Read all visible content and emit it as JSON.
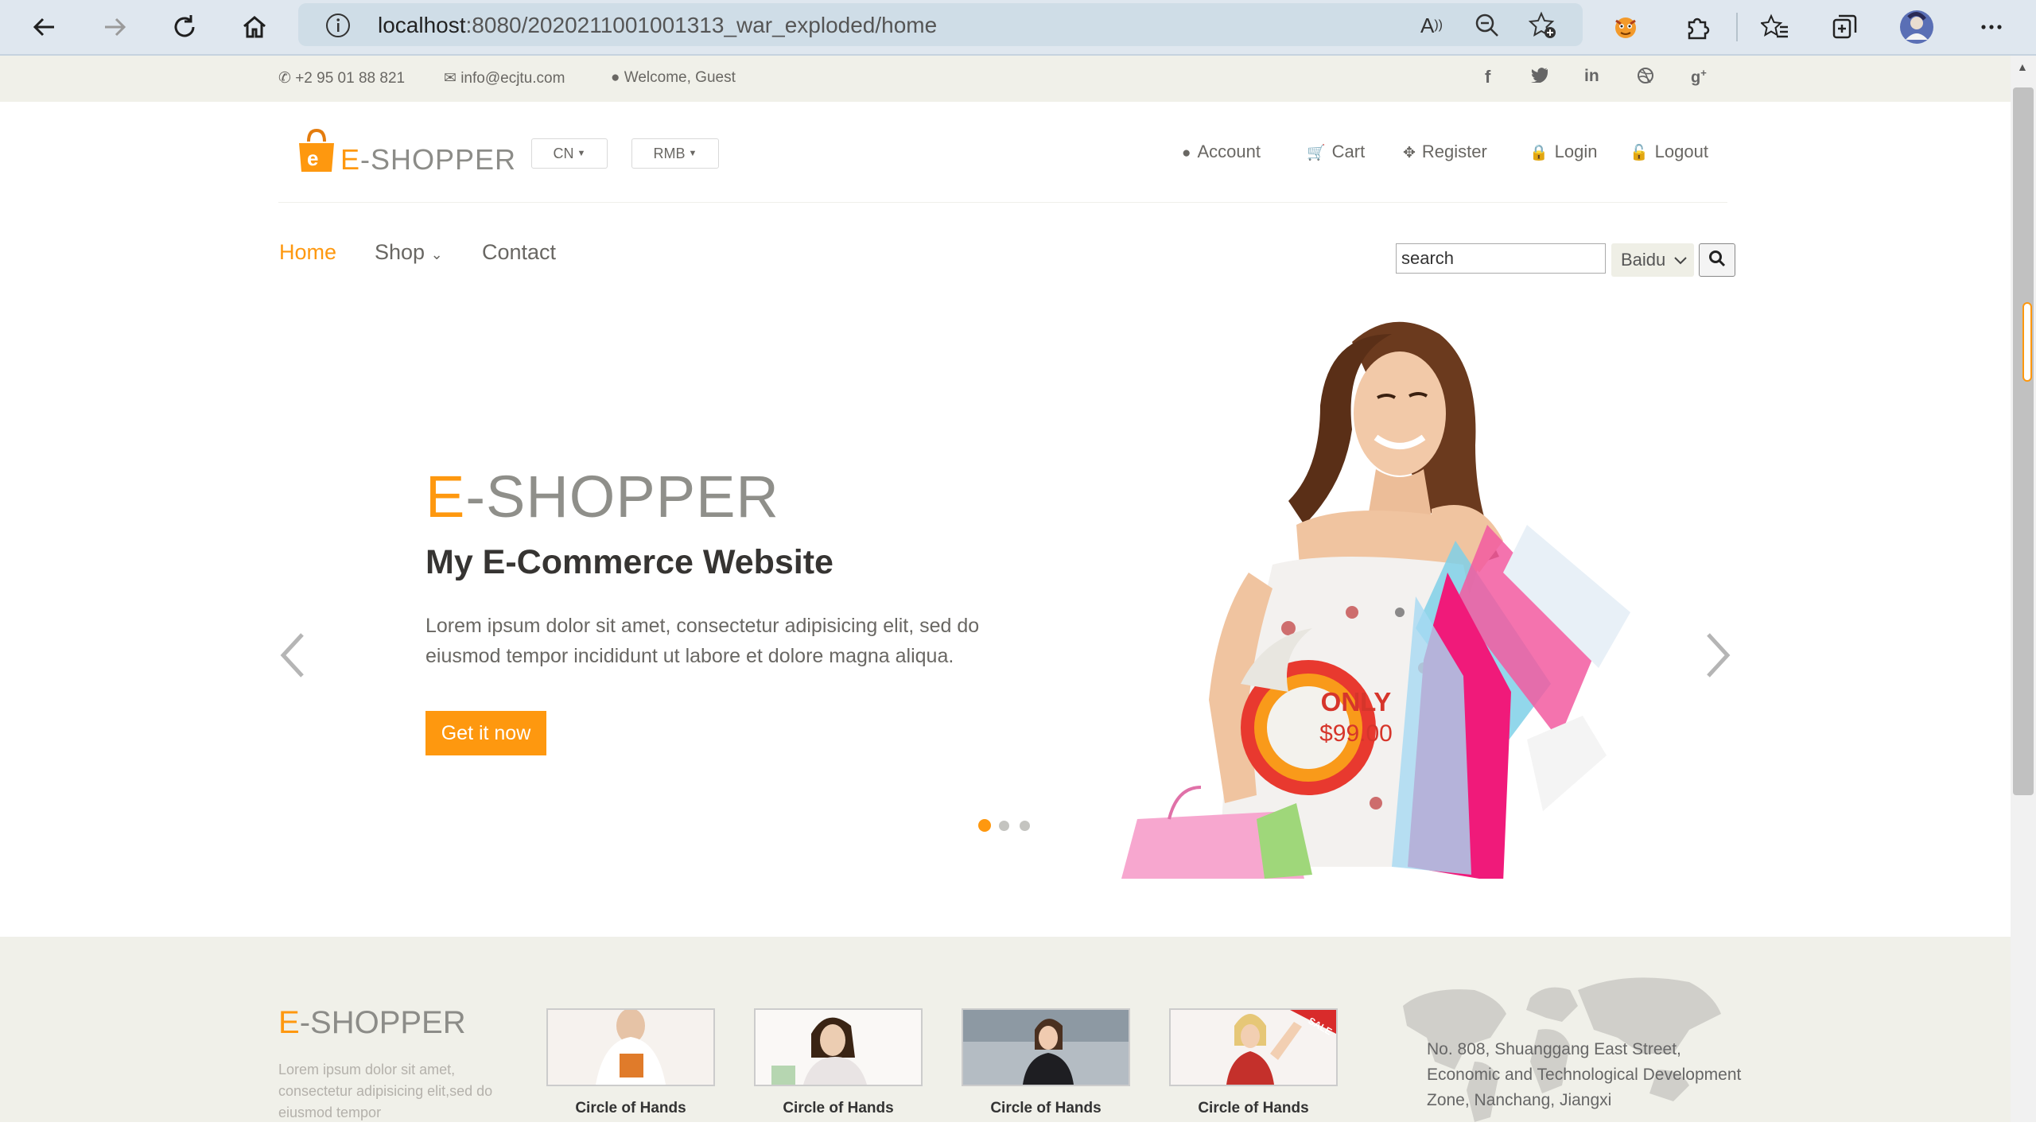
{
  "browser": {
    "url_host": "localhost",
    "url_rest": ":8080/2020211001001313_war_exploded/home"
  },
  "topbar": {
    "phone": "+2 95 01 88 821",
    "email": "info@ecjtu.com",
    "welcome": "Welcome, Guest"
  },
  "header": {
    "logo_e": "E",
    "logo_rest": "-SHOPPER",
    "lang": "CN",
    "currency": "RMB",
    "links": [
      "Account",
      "Cart",
      "Register",
      "Login",
      "Logout"
    ]
  },
  "menu": {
    "home": "Home",
    "shop": "Shop",
    "contact": "Contact"
  },
  "search": {
    "value": "search",
    "engine": "Baidu"
  },
  "slider": {
    "title_e": "E",
    "title_rest": "-SHOPPER",
    "subtitle": "My E-Commerce Website",
    "description": "Lorem ipsum dolor sit amet, consectetur adipisicing elit, sed do eiusmod tempor incididunt ut labore et dolore magna aliqua.",
    "button": "Get it now",
    "price_label": "ONLY",
    "price": "$99.00"
  },
  "footer": {
    "logo_e": "E",
    "logo_rest": "-SHOPPER",
    "description": "Lorem ipsum dolor sit amet, consectetur adipisicing elit,sed do eiusmod tempor",
    "thumbs": [
      "Circle of Hands",
      "Circle of Hands",
      "Circle of Hands",
      "Circle of Hands"
    ],
    "address": "No. 808, Shuanggang East Street, Economic and Technological Development Zone, Nanchang, Jiangxi"
  }
}
